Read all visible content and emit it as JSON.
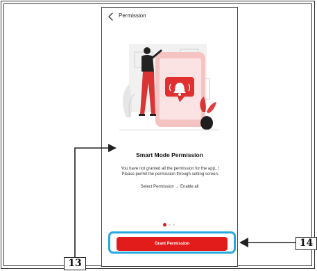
{
  "screen": {
    "title": "Permission",
    "back_icon": "chevron-left-icon",
    "heading": "Smart Mode Permission",
    "message_line1": "You have not granted all the permission for the app...!",
    "message_line2": "Please permit the permission through setting screen.",
    "hint": "Select Permission → Enable all",
    "pager": {
      "total": 3,
      "active": 1
    },
    "grant_button_label": "Grant Permission",
    "accent_color": "#e21b1b"
  },
  "callouts": {
    "label_13": "13",
    "label_14": "14",
    "highlight_color": "#29a8df"
  }
}
